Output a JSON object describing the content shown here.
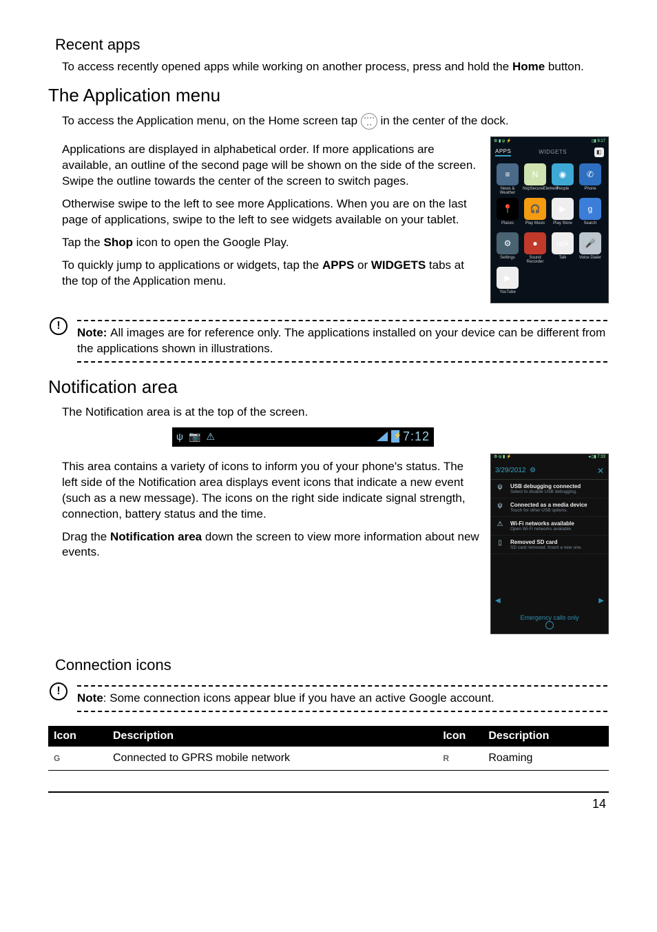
{
  "recent": {
    "heading": "Recent apps",
    "para_pre": "To access recently opened apps while working on another process, press and hold the ",
    "home_bold": "Home",
    "para_post": " button."
  },
  "appmenu": {
    "heading": "The Application menu",
    "p1_pre": "To access the Application menu, on the Home screen tap ",
    "p1_post": " in the center of the dock.",
    "p2": "Applications are displayed in alphabetical order. If more applications are available, an outline of the second page will be shown on the side of the screen. Swipe the outline towards the center of the screen to switch pages.",
    "p3": "Otherwise swipe to the left to see more Applications. When you are on the last page of applications, swipe to the left to see widgets available on your tablet.",
    "p4_pre": "Tap the ",
    "p4_bold": "Shop",
    "p4_post": " icon to open the Google Play.",
    "p5_pre": "To quickly jump to applications or widgets, tap the ",
    "p5_b1": "APPS",
    "p5_mid": " or ",
    "p5_b2": "WIDGETS",
    "p5_post": " tabs at the top of the Application menu.",
    "thumb": {
      "status_left": "⚙ ▮ ψ ⚡",
      "status_right": "▯▮ 9:17",
      "tabs": {
        "apps": "APPS",
        "widgets": "WIDGETS"
      },
      "apps": [
        {
          "label": "News & Weather",
          "bg": "#4a6a8a",
          "glyph": "≡"
        },
        {
          "label": "NxpSecureElement",
          "bg": "#cfe3b1",
          "glyph": "N"
        },
        {
          "label": "People",
          "bg": "#3fa9d6",
          "glyph": "◉"
        },
        {
          "label": "Phone",
          "bg": "#2f6fbf",
          "glyph": "✆"
        },
        {
          "label": "Places",
          "bg": "#000",
          "glyph": "📍"
        },
        {
          "label": "Play Music",
          "bg": "#f39c12",
          "glyph": "🎧"
        },
        {
          "label": "Play Store",
          "bg": "#eeeeee",
          "glyph": "▶"
        },
        {
          "label": "Search",
          "bg": "#3b7dd8",
          "glyph": "g"
        },
        {
          "label": "Settings",
          "bg": "#4a6373",
          "glyph": "⚙"
        },
        {
          "label": "Sound Recorder",
          "bg": "#c0392b",
          "glyph": "●"
        },
        {
          "label": "Talk",
          "bg": "#eeeeee",
          "glyph": "talk"
        },
        {
          "label": "Voice Dialer",
          "bg": "#bcc6cc",
          "glyph": "🎤"
        },
        {
          "label": "YouTube",
          "bg": "#eeeeee",
          "glyph": "▶"
        }
      ]
    },
    "note": {
      "bold": "Note: ",
      "text": "All images are for reference only. The applications installed on your device can be different from the applications shown in illustrations."
    }
  },
  "notif": {
    "heading": "Notification area",
    "p1": "The Notification area is at the top of the screen.",
    "statusbar": {
      "left_icons": [
        "ψ",
        "📷",
        "⚠"
      ],
      "time": "7:12"
    },
    "p2": "This area contains a variety of icons to inform you of your phone's status. The left side of the Notification area displays event icons that indicate a new event (such as a new message). The icons on the right side indicate signal strength, connection, battery status and the time.",
    "p3_pre": "Drag the ",
    "p3_bold": "Notification area",
    "p3_post": " down the screen to view more information about new events.",
    "thumb": {
      "status_left": "⚙ ψ ▮ ⚡",
      "status_right": "◂ ▯▮ 7:33",
      "date": "3/29/2012",
      "settings_glyph": "⚙",
      "rows": [
        {
          "icon": "ψ",
          "title": "USB debugging connected",
          "sub": "Select to disable USB debugging."
        },
        {
          "icon": "ψ",
          "title": "Connected as a media device",
          "sub": "Touch for other USB options."
        },
        {
          "icon": "⚠",
          "title": "Wi-Fi networks available",
          "sub": "Open Wi-Fi networks available"
        },
        {
          "icon": "▯",
          "title": "Removed SD card",
          "sub": "SD card removed. Insert a new one."
        }
      ],
      "emergency": "Emergency calls only"
    }
  },
  "conn": {
    "heading": "Connection icons",
    "note": {
      "bold": "Note",
      "text": ": Some connection icons appear blue if you have an active Google account."
    },
    "table": {
      "headers": [
        "Icon",
        "Description",
        "Icon",
        "Description"
      ],
      "rows": [
        {
          "icon1": "G",
          "desc1": "Connected to GPRS mobile network",
          "icon2": "R",
          "desc2": "Roaming"
        }
      ]
    }
  },
  "page_number": "14"
}
